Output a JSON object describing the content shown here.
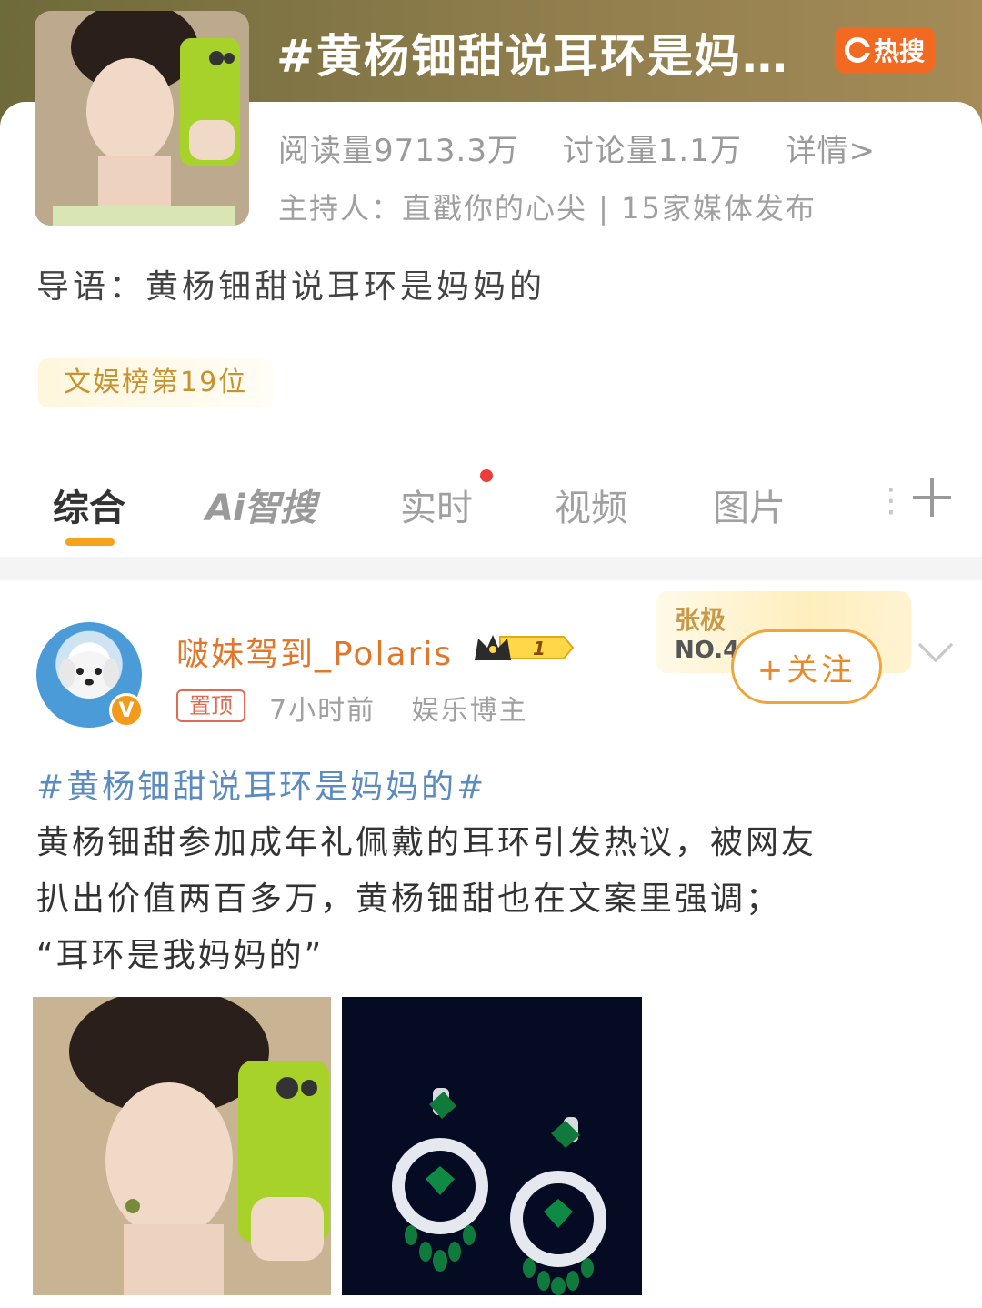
{
  "topic": {
    "title": "#黄杨钿甜说耳环是妈…",
    "hot_badge": "热搜",
    "reads": "阅读量9713.3万",
    "discussions": "讨论量1.1万",
    "details": "详情>",
    "host": "主持人：直戳你的心尖 | 15家媒体发布",
    "intro": "导语：黄杨钿甜说耳环是妈妈的",
    "rank": "文娱榜第19位"
  },
  "tabs": [
    {
      "label": "综合"
    },
    {
      "label": "Ai智搜"
    },
    {
      "label": "实时"
    },
    {
      "label": "视频"
    },
    {
      "label": "图片"
    }
  ],
  "tabs_more": "⋮",
  "post": {
    "username": "啵妹驾到_Polaris",
    "level": "1",
    "pin_label": "置顶",
    "time": "7小时前",
    "role": "娱乐博主",
    "rank_name": "张极",
    "rank_no": "NO.4",
    "follow_label": "+关注",
    "hashtag": "#黄杨钿甜说耳环是妈妈的#",
    "body_lines": [
      "黄杨钿甜参加成年礼佩戴的耳环引发热议，被网友",
      "扒出价值两百多万，黄杨钿甜也在文案里强调；",
      "“耳环是我妈妈的”"
    ]
  },
  "colors": {
    "accent_orange": "#f7a21b",
    "hot_orange": "#f26a21",
    "link_blue": "#5b8bbf",
    "username_orange": "#e0772a"
  }
}
